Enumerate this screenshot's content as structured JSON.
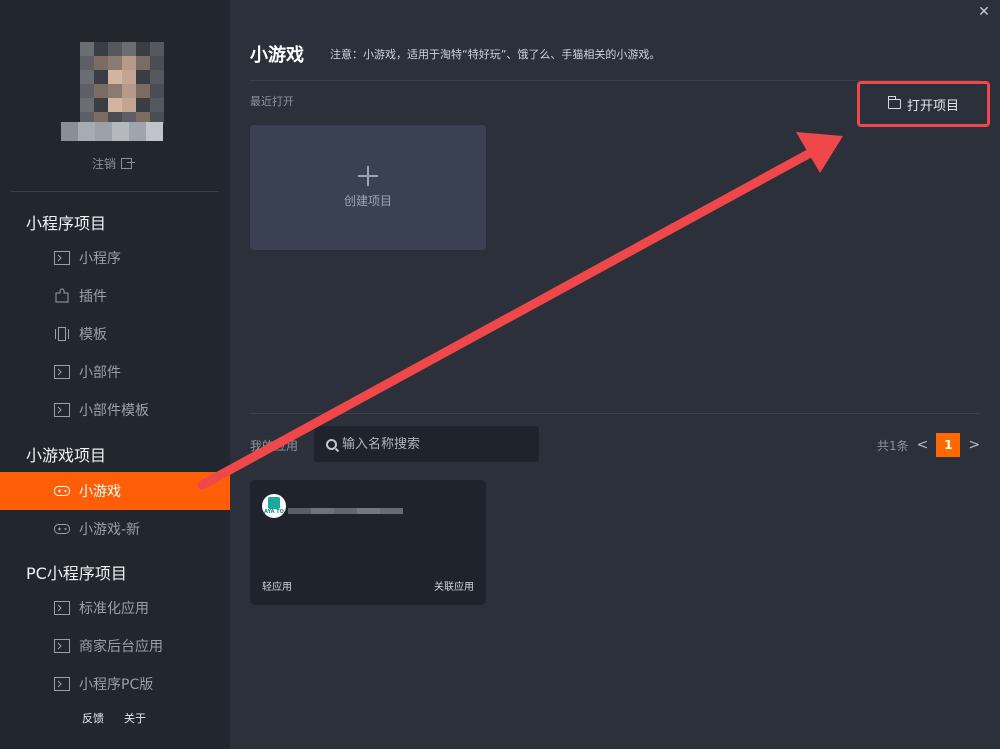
{
  "sidebar": {
    "logout_label": "注销",
    "sections": [
      {
        "title": "小程序项目",
        "items": [
          {
            "label": "小程序",
            "icon": "terminal-icon"
          },
          {
            "label": "插件",
            "icon": "puzzle-icon"
          },
          {
            "label": "模板",
            "icon": "template-icon"
          },
          {
            "label": "小部件",
            "icon": "terminal-icon"
          },
          {
            "label": "小部件模板",
            "icon": "terminal-icon"
          }
        ]
      },
      {
        "title": "小游戏项目",
        "items": [
          {
            "label": "小游戏",
            "icon": "gamepad-icon",
            "active": true
          },
          {
            "label": "小游戏-新",
            "icon": "gamepad-icon"
          }
        ]
      },
      {
        "title": "PC小程序项目",
        "items": [
          {
            "label": "标准化应用",
            "icon": "terminal-icon"
          },
          {
            "label": "商家后台应用",
            "icon": "terminal-icon"
          },
          {
            "label": "小程序PC版",
            "icon": "terminal-icon"
          }
        ]
      }
    ],
    "footer": {
      "feedback": "反馈",
      "about": "关于"
    }
  },
  "main": {
    "title": "小游戏",
    "notice": "注意：小游戏，适用于淘特“特好玩”、饿了么、手猫相关的小游戏。",
    "recent_label": "最近打开",
    "open_project": "打开项目",
    "create_project": "创建项目",
    "my_apps_label": "我的应用",
    "search_placeholder": "输入名称搜索",
    "pager": {
      "total": "共1条",
      "current_page": "1",
      "prev": "<",
      "next": ">"
    },
    "app_card": {
      "type": "轻应用",
      "link": "关联应用",
      "logo_text": "AYA TO"
    }
  },
  "colors": {
    "accent": "#ff5e08",
    "highlight_box": "#f0474a",
    "annotation_arrow": "#f0474a",
    "sidebar_bg": "#22262f",
    "main_bg": "#2b303b"
  }
}
